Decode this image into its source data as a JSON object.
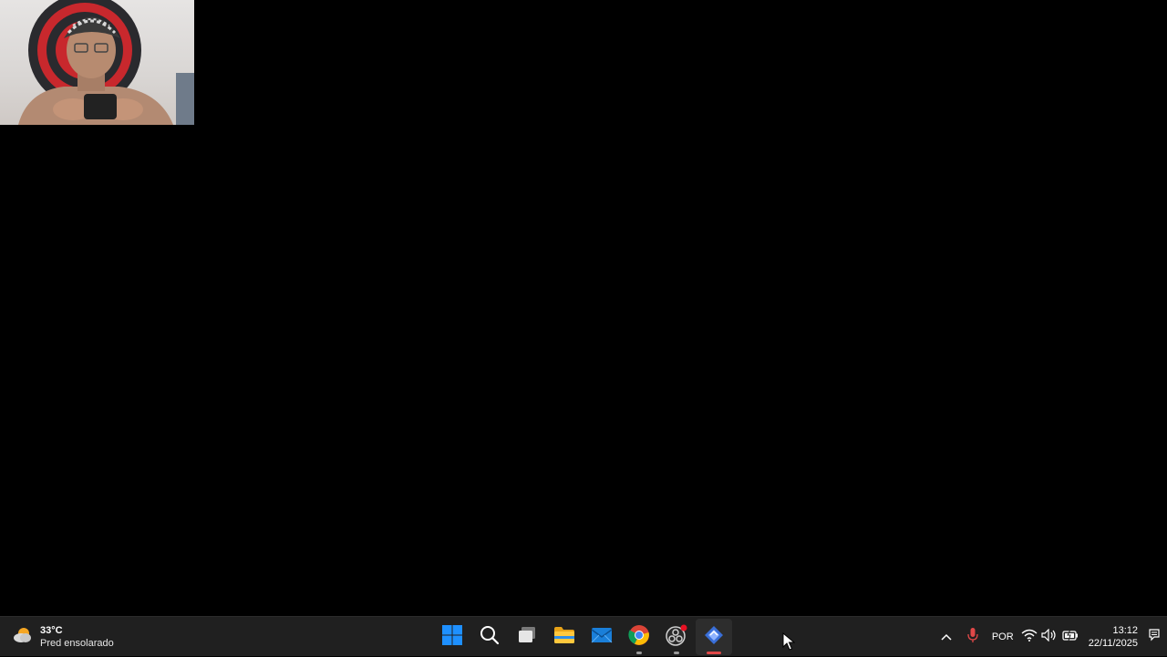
{
  "weather": {
    "temperature": "33°C",
    "condition": "Pred ensolarado",
    "icon": "sun-cloud-icon"
  },
  "taskbar": {
    "apps": [
      {
        "name": "start",
        "icon": "windows-start-icon",
        "active": false,
        "running": false
      },
      {
        "name": "search",
        "icon": "search-icon",
        "active": false,
        "running": false
      },
      {
        "name": "task-view",
        "icon": "task-view-icon",
        "active": false,
        "running": false
      },
      {
        "name": "file-explorer",
        "icon": "folder-icon",
        "active": false,
        "running": false
      },
      {
        "name": "mail",
        "icon": "mail-icon",
        "active": false,
        "running": false
      },
      {
        "name": "chrome",
        "icon": "chrome-icon",
        "active": false,
        "running": true
      },
      {
        "name": "obs",
        "icon": "obs-recording-icon",
        "active": false,
        "running": true
      },
      {
        "name": "editor",
        "icon": "app-diamond-icon",
        "active": true,
        "running": true
      }
    ]
  },
  "tray": {
    "language": "POR",
    "time": "13:12",
    "date": "22/11/2025"
  },
  "colors": {
    "taskbar_bg": "#202020",
    "accent_red": "#e04848",
    "start_blue": "#1e90ff"
  }
}
